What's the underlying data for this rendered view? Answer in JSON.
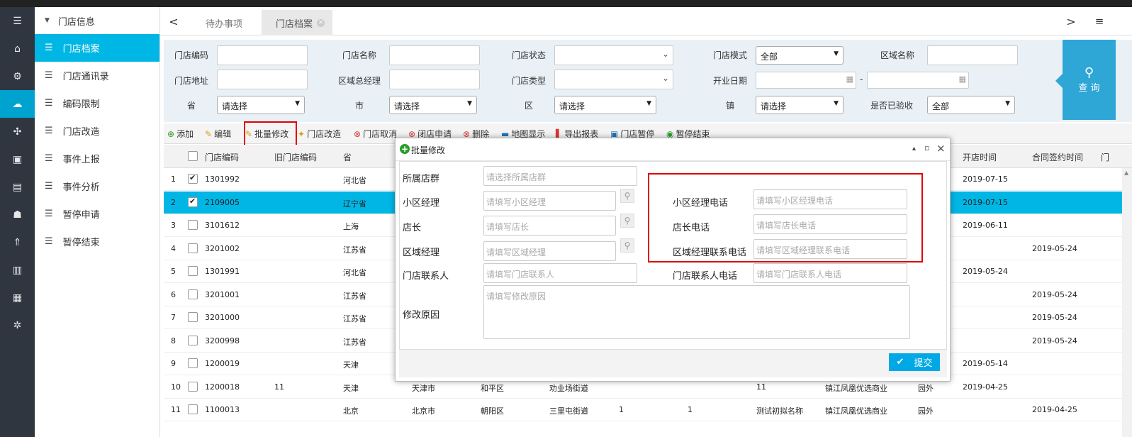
{
  "rail": {
    "icons": [
      "menu-icon",
      "home-icon",
      "user-cog-icon",
      "cluster-icon",
      "share-icon",
      "window-icon",
      "media-icon",
      "robot-icon",
      "rocket-icon",
      "printer-icon",
      "db-icon",
      "gear-icon"
    ]
  },
  "sidebar": {
    "group": "门店信息",
    "items": [
      "门店档案",
      "门店通讯录",
      "编码限制",
      "门店改造",
      "事件上报",
      "事件分析",
      "暂停申请",
      "暂停结束"
    ]
  },
  "tabs": {
    "prev": "<",
    "next": ">",
    "menu": "≡",
    "items": [
      {
        "label": "待办事项"
      },
      {
        "label": "门店档案"
      }
    ],
    "close": "×"
  },
  "filters": {
    "labels": [
      "门店编码",
      "门店名称",
      "门店状态",
      "门店模式",
      "区域名称",
      "门店地址",
      "区域总经理",
      "门店类型",
      "开业日期",
      "省",
      "市",
      "区",
      "镇",
      "是否已验收"
    ],
    "mode_value": "全部",
    "accepted_value": "全部",
    "placeholder": "请选择",
    "date_sep": "-"
  },
  "query_button": {
    "label": "查 询"
  },
  "toolbar": [
    "添加",
    "编辑",
    "批量修改",
    "门店改造",
    "门店取消",
    "闭店申请",
    "删除",
    "地图显示",
    "导出报表",
    "门店暂停",
    "暂停结束"
  ],
  "table": {
    "headers": [
      "门店编码",
      "旧门店编码",
      "省",
      "开店时间",
      "合同签约时间",
      "门"
    ],
    "rows": [
      {
        "n": "1",
        "code": "1301992",
        "old": "",
        "prov": "河北省",
        "city": "",
        "dist": "",
        "street": "",
        "a": "",
        "b": "",
        "name": "",
        "comp": "",
        "loc": "",
        "open": "2019-07-15",
        "sign": "",
        "checked": true
      },
      {
        "n": "2",
        "code": "2109005",
        "old": "",
        "prov": "辽宁省",
        "city": "",
        "dist": "",
        "street": "",
        "a": "",
        "b": "",
        "name": "",
        "comp": "",
        "loc": "",
        "open": "2019-07-15",
        "sign": "",
        "checked": true
      },
      {
        "n": "3",
        "code": "3101612",
        "old": "",
        "prov": "上海",
        "city": "",
        "dist": "",
        "street": "",
        "a": "",
        "b": "",
        "name": "",
        "comp": "",
        "loc": "",
        "open": "2019-06-11",
        "sign": "",
        "checked": false
      },
      {
        "n": "4",
        "code": "3201002",
        "old": "",
        "prov": "江苏省",
        "city": "",
        "dist": "",
        "street": "",
        "a": "",
        "b": "",
        "name": "",
        "comp": "",
        "loc": "",
        "open": "",
        "sign": "2019-05-24",
        "checked": false
      },
      {
        "n": "5",
        "code": "1301991",
        "old": "",
        "prov": "河北省",
        "city": "",
        "dist": "",
        "street": "",
        "a": "",
        "b": "",
        "name": "",
        "comp": "",
        "loc": "",
        "open": "2019-05-24",
        "sign": "",
        "checked": false
      },
      {
        "n": "6",
        "code": "3201001",
        "old": "",
        "prov": "江苏省",
        "city": "",
        "dist": "",
        "street": "",
        "a": "",
        "b": "",
        "name": "",
        "comp": "",
        "loc": "",
        "open": "",
        "sign": "2019-05-24",
        "checked": false
      },
      {
        "n": "7",
        "code": "3201000",
        "old": "",
        "prov": "江苏省",
        "city": "",
        "dist": "",
        "street": "",
        "a": "",
        "b": "",
        "name": "",
        "comp": "",
        "loc": "",
        "open": "",
        "sign": "2019-05-24",
        "checked": false
      },
      {
        "n": "8",
        "code": "3200998",
        "old": "",
        "prov": "江苏省",
        "city": "",
        "dist": "",
        "street": "",
        "a": "",
        "b": "",
        "name": "",
        "comp": "",
        "loc": "",
        "open": "",
        "sign": "2019-05-24",
        "checked": false
      },
      {
        "n": "9",
        "code": "1200019",
        "old": "",
        "prov": "天津",
        "city": "",
        "dist": "",
        "street": "",
        "a": "",
        "b": "",
        "name": "",
        "comp": "",
        "loc": "",
        "open": "2019-05-14",
        "sign": "",
        "checked": false
      },
      {
        "n": "10",
        "code": "1200018",
        "old": "11",
        "prov": "天津",
        "city": "天津市",
        "dist": "和平区",
        "street": "劝业场街道",
        "a": "",
        "b": "",
        "name": "11",
        "comp": "镇江凤凰优选商业",
        "loc": "园外",
        "open": "2019-04-25",
        "sign": "",
        "checked": false
      },
      {
        "n": "11",
        "code": "1100013",
        "old": "",
        "prov": "北京",
        "city": "北京市",
        "dist": "朝阳区",
        "street": "三里屯街道",
        "a": "1",
        "b": "1",
        "name": "测试初拟名称",
        "comp": "镇江凤凰优选商业",
        "loc": "园外",
        "open": "",
        "sign": "2019-04-25",
        "checked": false
      }
    ]
  },
  "dialog": {
    "title": "批量修改",
    "controls": [
      "▴",
      "▫",
      "×"
    ],
    "labels": {
      "group": "所属店群",
      "district_mgr": "小区经理",
      "store_mgr": "店长",
      "region_mgr": "区域经理",
      "contact": "门店联系人",
      "reason": "修改原因",
      "district_phone": "小区经理电话",
      "store_phone": "店长电话",
      "region_phone": "区域经理联系电话",
      "contact_phone": "门店联系人电话"
    },
    "placeholders": {
      "group": "请选择所属店群",
      "district_mgr": "请填写小区经理",
      "store_mgr": "请填写店长",
      "region_mgr": "请填写区域经理",
      "contact": "请填写门店联系人",
      "reason": "请填写修改原因",
      "district_phone": "请填写小区经理电话",
      "store_phone": "请填写店长电话",
      "region_phone": "请填写区域经理联系电话",
      "contact_phone": "请填写门店联系人电话"
    },
    "submit": "提交"
  }
}
